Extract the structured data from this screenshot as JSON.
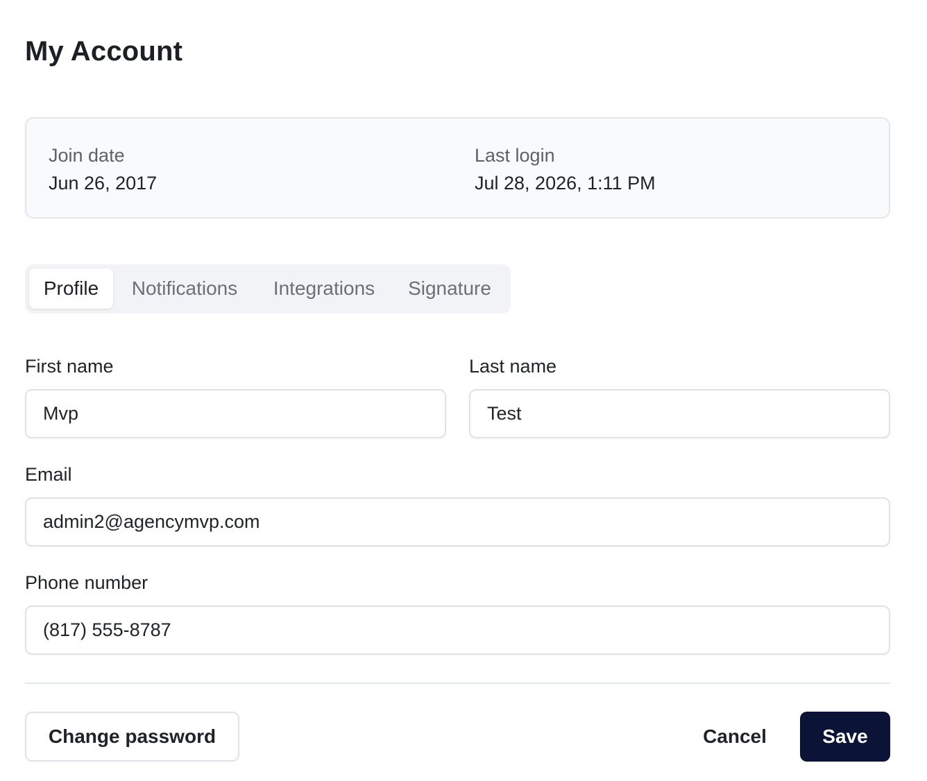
{
  "page": {
    "title": "My Account"
  },
  "info": {
    "join_date_label": "Join date",
    "join_date_value": "Jun 26, 2017",
    "last_login_label": "Last login",
    "last_login_value": "Jul 28, 2026, 1:11 PM"
  },
  "tabs": [
    {
      "label": "Profile",
      "active": true
    },
    {
      "label": "Notifications",
      "active": false
    },
    {
      "label": "Integrations",
      "active": false
    },
    {
      "label": "Signature",
      "active": false
    }
  ],
  "form": {
    "first_name_label": "First name",
    "first_name_value": "Mvp",
    "last_name_label": "Last name",
    "last_name_value": "Test",
    "email_label": "Email",
    "email_value": "admin2@agencymvp.com",
    "phone_label": "Phone number",
    "phone_value": "(817) 555-8787"
  },
  "actions": {
    "change_password_label": "Change password",
    "cancel_label": "Cancel",
    "save_label": "Save"
  },
  "colors": {
    "primary": "#0b1437",
    "panel_bg": "#f9fafc",
    "tabs_bg": "#f1f3f6"
  }
}
